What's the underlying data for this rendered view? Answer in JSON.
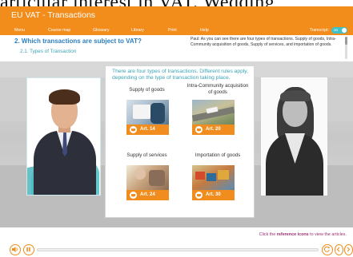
{
  "window": {
    "bleed_text": "articular interest in VAT. Wedding",
    "app_title": "EU VAT - Transactions",
    "menu": [
      "Menu",
      "Course map",
      "Glossary",
      "Library",
      "Print",
      "Help"
    ],
    "transcript_label": "Transcript:",
    "transcript_toggle_state": "on"
  },
  "header": {
    "title": "2. Which transactions are subject to VAT?",
    "subtitle": "2.1. Types of Transaction",
    "transcript": "Paul: As you can see there are four types of transactions. Supply of goods, Intra-Community acquisition of goods, Supply of services, and importation of goods."
  },
  "panel": {
    "intro": "There are four types of transactions. Different rules apply, depending on the type of transaction taking place.",
    "tiles": [
      {
        "label": "Supply of goods",
        "article": "Art. 14"
      },
      {
        "label": "Intra-Community acquisition of goods",
        "article": "Art. 20"
      },
      {
        "label": "Supply of services",
        "article": "Art. 24"
      },
      {
        "label": "Importation of goods",
        "article": "Art. 30"
      }
    ]
  },
  "footer": {
    "note_prefix": "Click the",
    "note_bold": "reference icons",
    "note_suffix": "to view the articles.",
    "progress_fraction": 0.0
  },
  "icons": {
    "audio": "speaker-icon",
    "pause": "pause-icon",
    "replay": "replay-icon",
    "back": "chevron-left-icon",
    "next": "chevron-right-icon",
    "reference": "book-icon"
  },
  "colors": {
    "brand_orange": "#f28c1b",
    "accent_teal": "#3aa4b6",
    "title_blue": "#2e7fc1",
    "note_magenta": "#9c2f6f"
  }
}
